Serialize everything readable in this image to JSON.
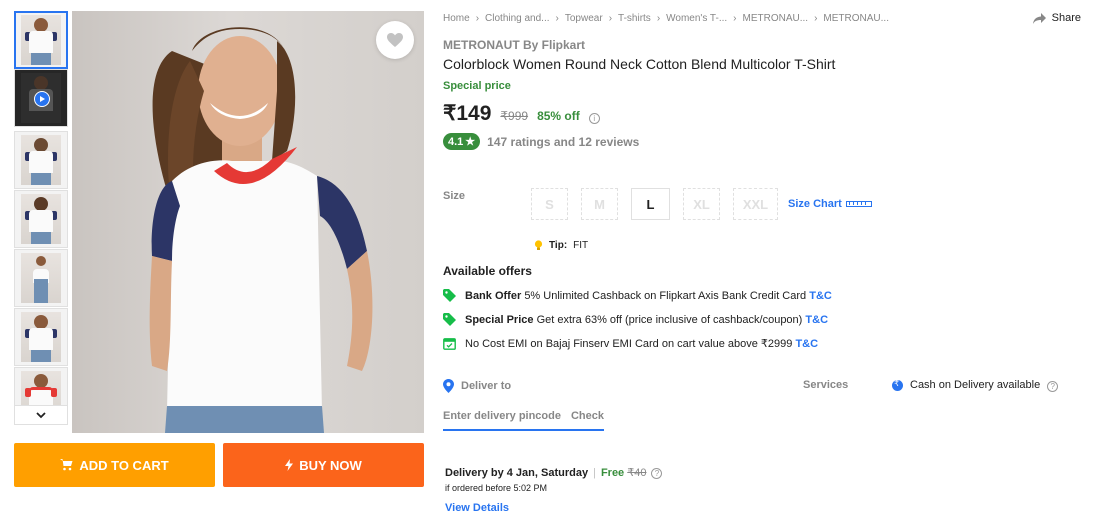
{
  "thumbnails": {
    "count_shown": 7,
    "scroll_icon": "chevron-down-icon"
  },
  "wishlist_icon": "heart-icon",
  "buttons": {
    "add_to_cart": "ADD TO CART",
    "buy_now": "BUY NOW"
  },
  "breadcrumbs": [
    "Home",
    "Clothing and...",
    "Topwear",
    "T-shirts",
    "Women's T-...",
    "METRONAU...",
    "METRONAU..."
  ],
  "share_label": "Share",
  "product": {
    "brand": "METRONAUT By Flipkart",
    "title": "Colorblock Women Round Neck Cotton Blend Multicolor T-Shirt",
    "special_label": "Special price",
    "price": "₹149",
    "mrp": "₹999",
    "discount": "85% off",
    "rating": "4.1",
    "ratings_text": "147 ratings and 12 reviews"
  },
  "size": {
    "label": "Size",
    "options": [
      "S",
      "M",
      "L",
      "XL",
      "XXL"
    ],
    "selected": "L",
    "chart_label": "Size Chart",
    "tip_label": "Tip:",
    "tip_value": "FIT"
  },
  "offers": {
    "title": "Available offers",
    "items": [
      {
        "bold": "Bank Offer",
        "text": "5% Unlimited Cashback on Flipkart Axis Bank Credit Card",
        "link": "T&C"
      },
      {
        "bold": "Special Price",
        "text": "Get extra 63% off (price inclusive of cashback/coupon)",
        "link": "T&C"
      },
      {
        "bold": "",
        "text": "No Cost EMI on Bajaj Finserv EMI Card on cart value above ₹2999",
        "link": "T&C"
      }
    ]
  },
  "delivery": {
    "deliver_to": "Deliver to",
    "pincode_placeholder": "Enter delivery pincode",
    "check_label": "Check",
    "date_text": "Delivery by 4 Jan, Saturday",
    "free_label": "Free",
    "free_strike": "₹40",
    "order_before": "if ordered before 5:02 PM",
    "view_details": "View Details"
  },
  "services": {
    "label": "Services",
    "cod": "Cash on Delivery available"
  },
  "colors": {
    "accent": "#2874f0",
    "green": "#388e3c",
    "cart": "#ff9f00",
    "buy": "#fb641b"
  }
}
